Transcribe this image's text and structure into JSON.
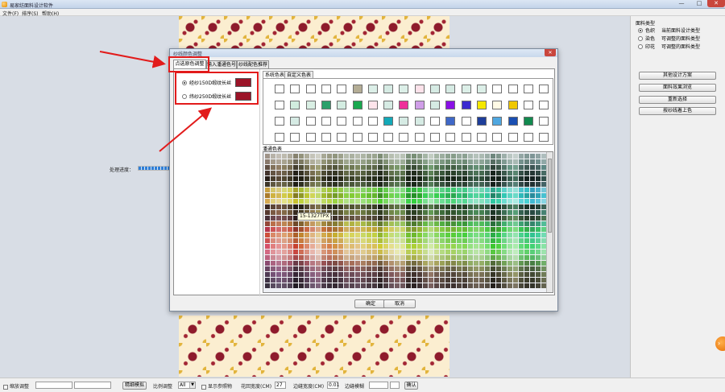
{
  "window": {
    "title": "易家纺面料设计软件",
    "icon": "app-logo-icon",
    "controls": [
      "minimize-icon",
      "maximize-icon",
      "close-icon"
    ]
  },
  "menu": [
    "文件(F)",
    "排序(S)",
    "帮助(H)"
  ],
  "workspace": {
    "progress_label": "处理进度：",
    "progress": 0.95
  },
  "right_panel": {
    "title": "面料类型",
    "options": [
      {
        "label": "色织",
        "desc": "当前面料设计类型",
        "selected": true
      },
      {
        "label": "染色",
        "desc": "可调整的面料类型",
        "selected": false
      },
      {
        "label": "印花",
        "desc": "可调整的面料类型",
        "selected": false
      }
    ],
    "buttons": [
      "其他设计方案",
      "面料效果浏览",
      "重新选择",
      "按纱线着上色"
    ]
  },
  "dialog": {
    "title": "纱线颜色调整",
    "tabs": [
      "点选原色调整",
      "输入潘通色号",
      "纱线配色推荐"
    ],
    "active_tab": 0,
    "yarn_rows": [
      {
        "label": "经纱150D缎纹长丝",
        "color": "#9b1428",
        "selected": true
      },
      {
        "label": "纬纱250D缎纹长丝",
        "color": "#9b1428",
        "selected": false
      }
    ],
    "palette_tabs": [
      "系统色表",
      "自定义色表"
    ],
    "palette_colors": [
      [
        "#ffffff",
        "#ffffff",
        "#ffffff",
        "#ffffff",
        "#ffffff",
        "#b4ad95",
        "#dcefe8",
        "#d6ebe4",
        "#dcefe8",
        "#fde2ea",
        "#d6ebe4",
        "#d6ebe4",
        "#dcefe8",
        "#dcefe8",
        "#ffffff",
        "#ffffff",
        "#ffffff",
        "#ffffff"
      ],
      [
        "#ffffff",
        "#d1ecdf",
        "#d9efe4",
        "#2aa06b",
        "#d4ede2",
        "#1aa84f",
        "#fde4eb",
        "#d6ebe4",
        "#ee2f9a",
        "#d09ee8",
        "#d6ebe4",
        "#8a10e6",
        "#3b2bd0",
        "#f5e800",
        "#fffbe6",
        "#f0c800",
        "#ffffff",
        "#ffffff"
      ],
      [
        "#ffffff",
        "#d6ebe4",
        "#ffffff",
        "#ffffff",
        "#ffffff",
        "#ffffff",
        "#ffffff",
        "#13a9b8",
        "#d6ebe4",
        "#d6ebe4",
        "#ffffff",
        "#3f68c8",
        "#ffffff",
        "#1e3e9a",
        "#4fa7e0",
        "#1a4fb2",
        "#128a4f",
        "#ffffff"
      ],
      [
        "#ffffff",
        "#ffffff",
        "#ffffff",
        "#ffffff",
        "#ffffff",
        "#ffffff",
        "#ffffff",
        "#ffffff",
        "#ffffff",
        "#ffffff",
        "#ffffff",
        "#ffffff",
        "#ffffff",
        "#ffffff",
        "#ffffff",
        "#ffffff",
        "#ffffff",
        "#ffffff"
      ]
    ],
    "standard_label": "潘通色表",
    "tooltip": "15-1327TPX",
    "ok": "确定",
    "cancel": "取消"
  },
  "bottom_bar": {
    "zoom_label": "缩放调整",
    "fit_button": "精细模拟",
    "ratio_label": "比例调整",
    "ratio_value": "All",
    "show_ref_label": "显示参照物",
    "pattern_width_label": "花回宽度(CM)",
    "pattern_width_value": "27",
    "edge_width_label": "边缝宽度(CM)",
    "edge_width_value": "0.01",
    "edge_mode_label": "边缝模糊",
    "confirm": "确认"
  }
}
